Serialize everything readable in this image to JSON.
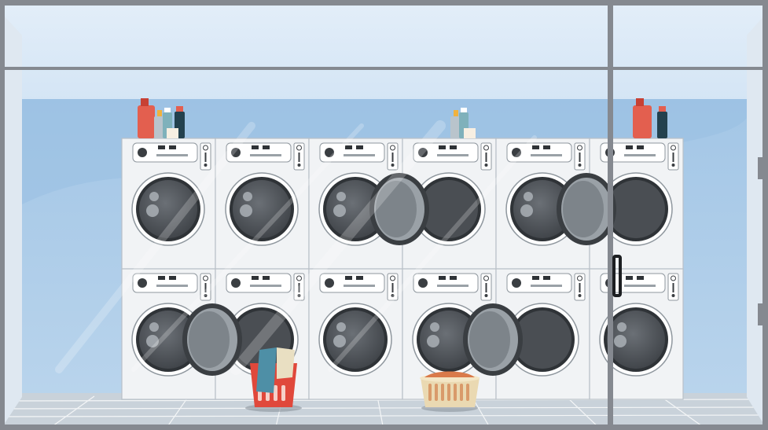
{
  "scene": {
    "subject": "laundromat-storefront",
    "colors": {
      "frame": "#858990",
      "wall": "#a6c8e6",
      "wall_light": "#c5dcf1",
      "ceiling": "#dbe9f7",
      "floor": "#c9d2da",
      "machine_body": "#f1f3f5",
      "machine_outline": "#b9c0c7",
      "drum_dark": "#4a4e53",
      "detergent_red": "#e35f4f",
      "detergent_navy": "#23414e",
      "basket_red": "#e0483b",
      "basket_wicker": "#ead9b2"
    },
    "machine_rows": [
      {
        "row": "top",
        "doors": [
          "closed",
          "closed",
          "closed",
          "open",
          "closed",
          "open"
        ]
      },
      {
        "row": "bottom",
        "doors": [
          "closed",
          "open",
          "closed",
          "closed",
          "open",
          "closed"
        ]
      }
    ],
    "icons": [
      "detergent-bottle-icon",
      "laundry-basket-icon",
      "door-handle-icon"
    ]
  }
}
